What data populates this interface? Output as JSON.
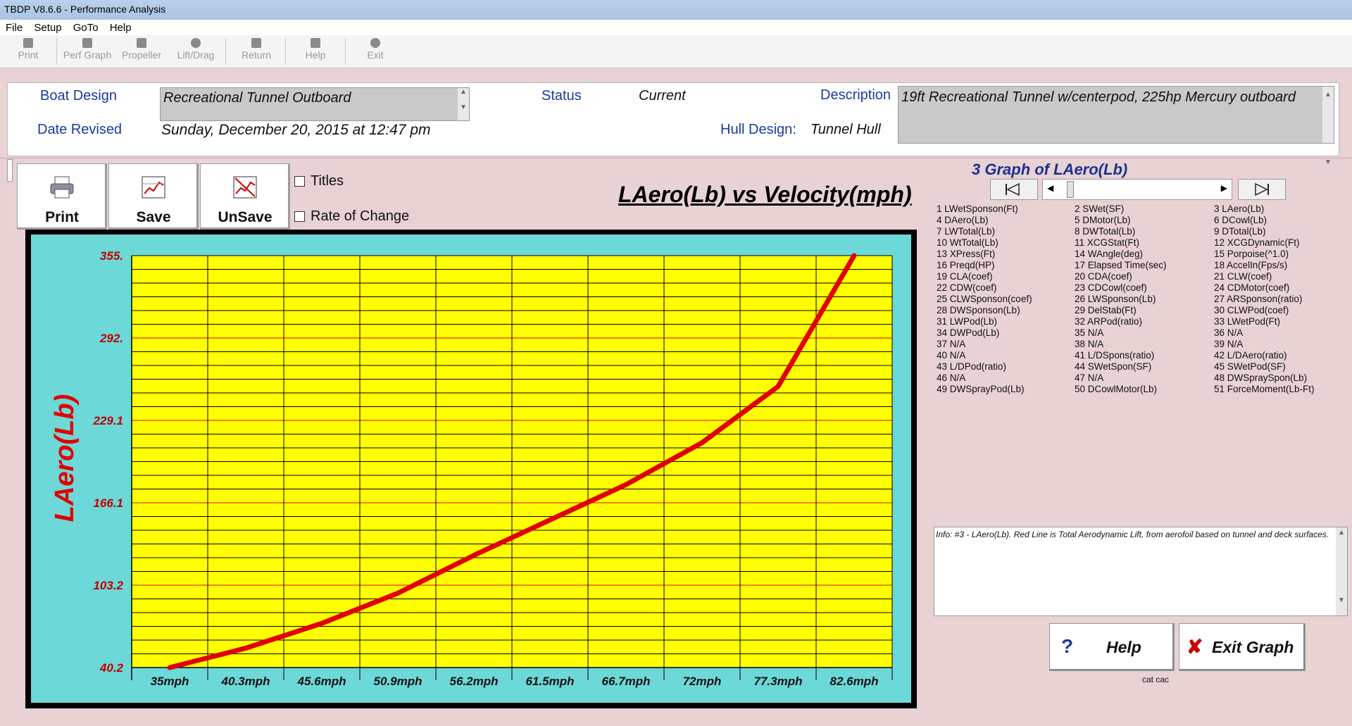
{
  "window": {
    "title": "TBDP V8.6.6 - Performance Analysis"
  },
  "menu": [
    "File",
    "Setup",
    "GoTo",
    "Help"
  ],
  "toolbar": [
    "Print",
    "Perf Graph",
    "Propeller",
    "Lift/Drag",
    "Return",
    "Help",
    "Exit"
  ],
  "header": {
    "boat_design_label": "Boat Design",
    "boat_design_value": "Recreational Tunnel Outboard",
    "date_revised_label": "Date Revised",
    "date_revised_value": "Sunday, December 20, 2015 at 12:47 pm",
    "status_label": "Status",
    "status_value": "Current",
    "description_label": "Description",
    "description_value": "19ft Recreational Tunnel w/centerpod, 225hp Mercury outboard",
    "hull_design_label": "Hull Design:",
    "hull_design_value": "Tunnel Hull"
  },
  "graph_buttons": {
    "print": "Print",
    "save": "Save",
    "unsave": "UnSave"
  },
  "options": {
    "titles": "Titles",
    "rate_of_change": "Rate of Change"
  },
  "right_panel": {
    "title": "3 Graph of LAero(Lb)",
    "info": "Info: #3 - LAero(Lb). Red Line is Total Aerodynamic Lift, from aerofoil based on tunnel and deck surfaces.",
    "help_button": "Help",
    "exit_button": "Exit Graph",
    "footer_text": "cat cac",
    "list_col1": [
      "1 LWetSponson(Ft)",
      "4 DAero(Lb)",
      "7 LWTotal(Lb)",
      "10 WtTotal(Lb)",
      "13 XPress(Ft)",
      "16 Preqd(HP)",
      "19 CLA(coef)",
      "22 CDW(coef)",
      "25 CLWSponson(coef)",
      "28 DWSponson(Lb)",
      "31 LWPod(Lb)",
      "34 DWPod(Lb)",
      "37 N/A",
      "40 N/A",
      "43 L/DPod(ratio)",
      "46 N/A",
      "49 DWSprayPod(Lb)"
    ],
    "list_col2": [
      "2 SWet(SF)",
      "5 DMotor(Lb)",
      "8 DWTotal(Lb)",
      "11 XCGStat(Ft)",
      "14 WAngle(deg)",
      "17 Elapsed Time(sec)",
      "20 CDA(coef)",
      "23 CDCowl(coef)",
      "26 LWSponson(Lb)",
      "29 DelStab(Ft)",
      "32 ARPod(ratio)",
      "35 N/A",
      "38 N/A",
      "41 L/DSpons(ratio)",
      "44 SWetSpon(SF)",
      "47 N/A",
      "50 DCowlMotor(Lb)"
    ],
    "list_col3": [
      "3 LAero(Lb)",
      "6 DCowl(Lb)",
      "9 DTotal(Lb)",
      "12 XCGDynamic(Ft)",
      "15 Porpoise(^1.0)",
      "18 AccelIn(Fps/s)",
      "21 CLW(coef)",
      "24 CDMotor(coef)",
      "27 ARSponson(ratio)",
      "30 CLWPod(coef)",
      "33 LWetPod(Ft)",
      "36 N/A",
      "39 N/A",
      "42 L/DAero(ratio)",
      "45 SWetPod(SF)",
      "48 DWSpraySpon(Lb)",
      "51 ForceMoment(Lb-Ft)"
    ]
  },
  "colors": {
    "plot_bg": "#ffff00",
    "frame_bg": "#6dd8d8",
    "line": "#e00000",
    "axis_text": "#c00000"
  },
  "chart_data": {
    "type": "line",
    "title": "LAero(Lb) vs Velocity(mph)",
    "ylabel": "LAero(Lb)",
    "xlabel": "",
    "categories": [
      "35mph",
      "40.3mph",
      "45.6mph",
      "50.9mph",
      "56.2mph",
      "61.5mph",
      "66.7mph",
      "72mph",
      "77.3mph",
      "82.6mph"
    ],
    "y_ticks": [
      "40.2",
      "103.2",
      "166.1",
      "229.1",
      "292.",
      "355."
    ],
    "ylim": [
      40.2,
      355
    ],
    "grid": true,
    "series": [
      {
        "values": [
          40.2,
          55,
          74,
          97,
          126,
          153,
          180,
          212,
          255,
          355
        ]
      }
    ]
  }
}
